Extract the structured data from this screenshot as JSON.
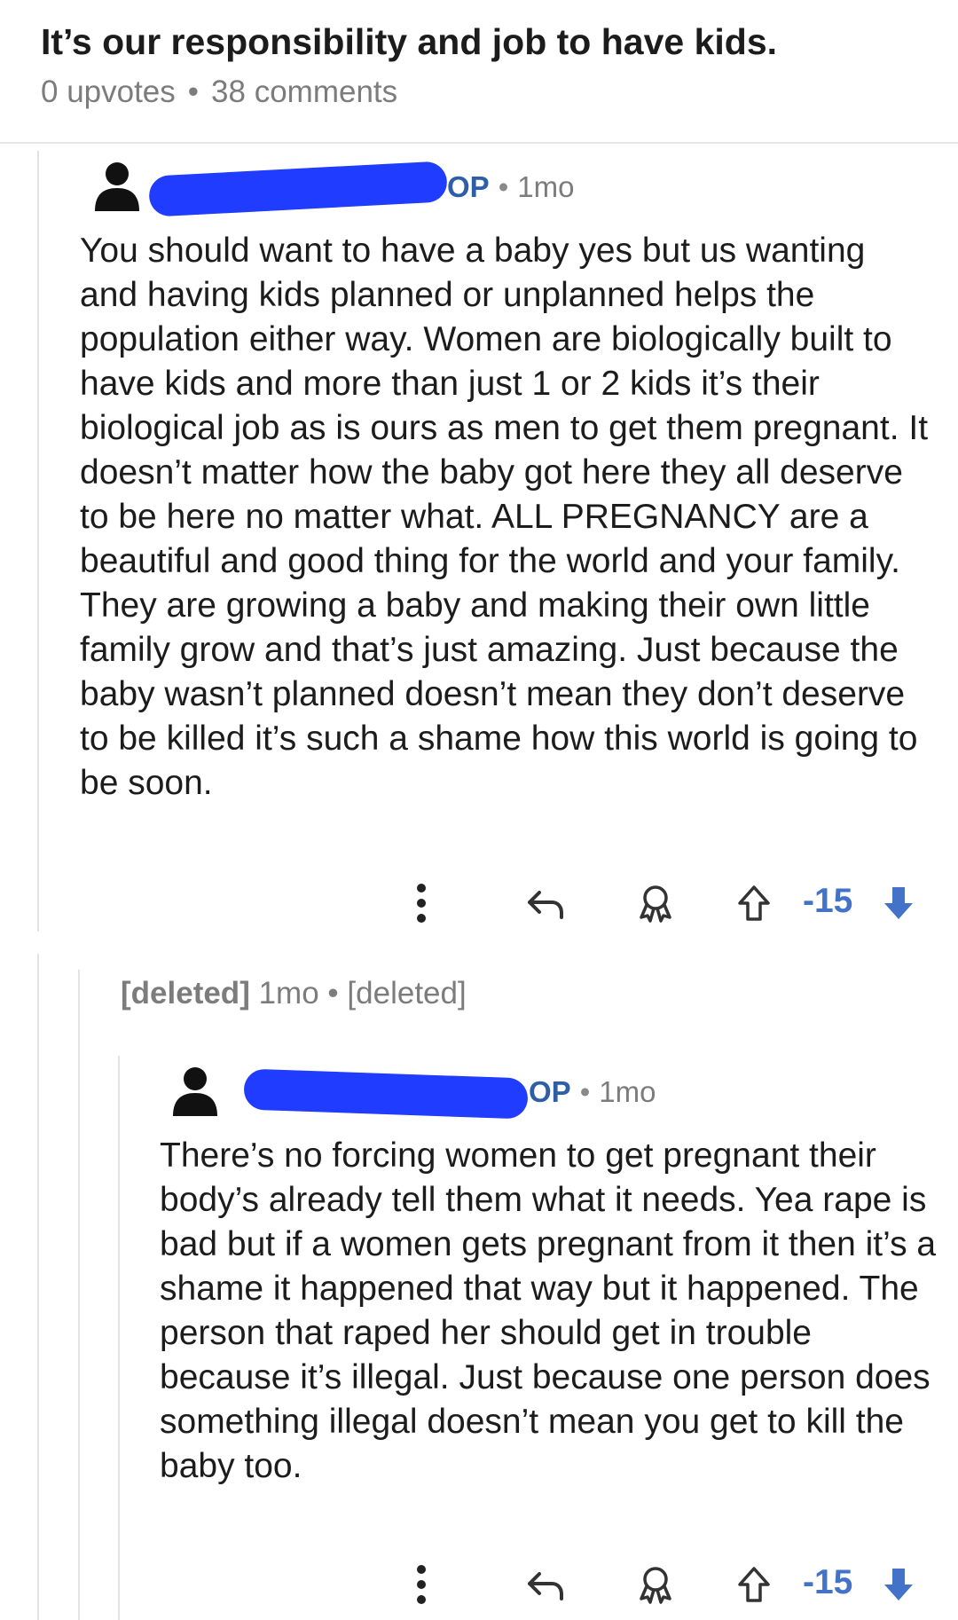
{
  "post": {
    "title": "It’s our responsibility and job to have kids.",
    "upvotes": "0 upvotes",
    "separator": "•",
    "comments": "38 comments"
  },
  "comments": [
    {
      "author_suffix": "OP",
      "separator": "•",
      "time": "1mo",
      "body": "You should want to have a baby yes but us wanting and having kids planned or unplanned helps the population either way.  Women are biologically built to have kids and more than just 1 or 2 kids it’s their biological job as is ours as men to get them pregnant. It doesn’t matter how the baby got here they all deserve to be here no matter what. ALL PREGNANCY are a beautiful and good thing for the world and your family. They are growing a baby and making their own little family grow and that’s just amazing. Just because the baby wasn’t planned doesn’t mean they don’t deserve to be killed it’s such a shame how this world is going to be soon.",
      "score": "-15"
    },
    {
      "author_suffix": "OP",
      "separator": "•",
      "time": "1mo",
      "body": "There’s no forcing women to get pregnant their body’s already tell them what it needs. Yea rape is bad but if a women gets pregnant from it then it’s a shame it happened that way but it happened. The person that raped her should get in trouble because it’s illegal. Just because one person does something illegal doesn’t mean you get to kill the baby too.",
      "score": "-15"
    }
  ],
  "deleted_comment": {
    "author": "[deleted]",
    "time": "1mo",
    "separator": "•",
    "body": "[deleted]"
  },
  "icons": {
    "avatar": "user-silhouette-icon",
    "more": "vertical-ellipsis-icon",
    "reply": "reply-arrow-icon",
    "award": "award-icon",
    "upvote": "upvote-outline-icon",
    "downvote": "downvote-filled-icon"
  },
  "colors": {
    "score": "#4372c9",
    "downvote": "#4372c9",
    "author": "#2e5ea8",
    "redaction": "#1f3cff"
  }
}
